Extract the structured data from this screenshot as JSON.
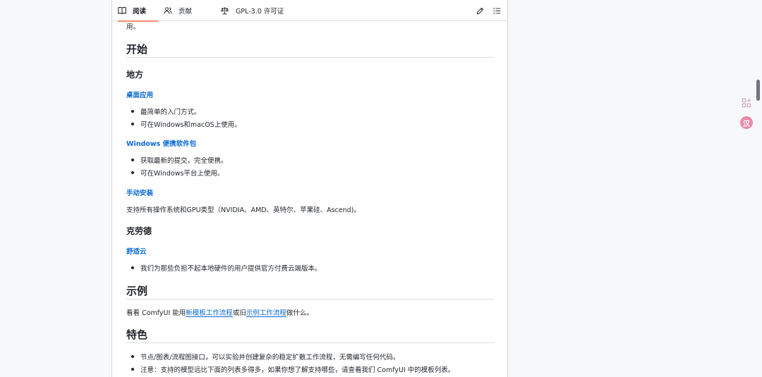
{
  "tabs": {
    "readme": "阅读",
    "contributing": "贡献",
    "license": "GPL-3.0 许可证"
  },
  "content": {
    "cut_text": "用。",
    "h_getting_started": "开始",
    "h_local": "地方",
    "h_desktop": "桌面应用",
    "desktop_items": [
      "最简单的入门方式。",
      "可在Windows和macOS上使用。"
    ],
    "h_portable": "Windows 便携软件包",
    "portable_items": [
      "获取最新的提交，完全便携。",
      "可在Windows平台上使用。"
    ],
    "h_manual": "手动安装",
    "manual_text": "支持所有操作系统和GPU类型（NVIDIA、AMD、英特尔、苹果硅、Ascend)。",
    "h_cloud": "克劳德",
    "h_comfy_cloud": "舒适云",
    "cloud_items": [
      "我们为那些负担不起本地硬件的用户提供官方付费云端版本。"
    ],
    "h_examples": "示例",
    "examples_pre": "看看 ComfyUI 能用",
    "examples_link1": "新模板工作流程",
    "examples_mid": "或旧",
    "examples_link2": "示例工作流程",
    "examples_post": "做什么。",
    "h_features": "特色",
    "feature_items": [
      "节点/图表/流程图接口，可以实验并创建复杂的稳定扩散工作流程，无需编写任何代码。",
      "注意：支持的模型远比下面的列表多得多，如果你想了解支持哪些，请查看我们 ComfyUI 中的模板列表。"
    ]
  },
  "side": {
    "translate_badge": "汉"
  },
  "icons": [
    "book-icon",
    "people-icon",
    "law-icon",
    "pencil-icon",
    "list-icon",
    "sparkle-icon",
    "translate-icon"
  ]
}
